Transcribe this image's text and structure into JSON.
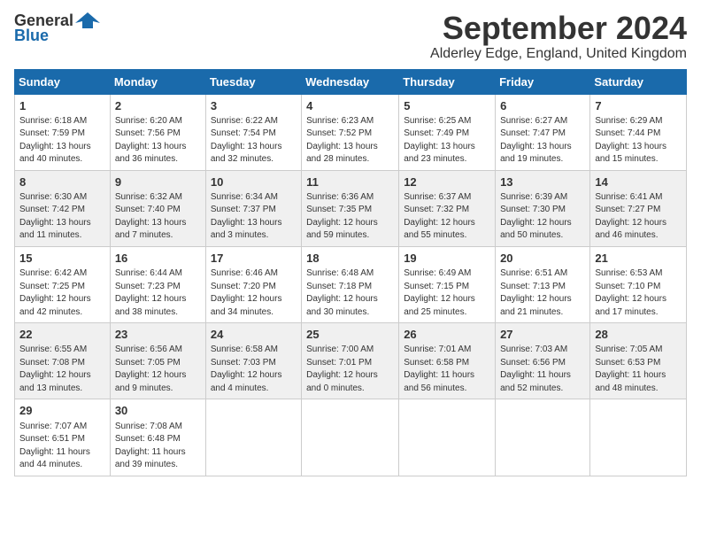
{
  "header": {
    "logo_general": "General",
    "logo_blue": "Blue",
    "month_title": "September 2024",
    "location": "Alderley Edge, England, United Kingdom"
  },
  "days_of_week": [
    "Sunday",
    "Monday",
    "Tuesday",
    "Wednesday",
    "Thursday",
    "Friday",
    "Saturday"
  ],
  "weeks": [
    [
      {
        "day": "1",
        "info": "Sunrise: 6:18 AM\nSunset: 7:59 PM\nDaylight: 13 hours\nand 40 minutes."
      },
      {
        "day": "2",
        "info": "Sunrise: 6:20 AM\nSunset: 7:56 PM\nDaylight: 13 hours\nand 36 minutes."
      },
      {
        "day": "3",
        "info": "Sunrise: 6:22 AM\nSunset: 7:54 PM\nDaylight: 13 hours\nand 32 minutes."
      },
      {
        "day": "4",
        "info": "Sunrise: 6:23 AM\nSunset: 7:52 PM\nDaylight: 13 hours\nand 28 minutes."
      },
      {
        "day": "5",
        "info": "Sunrise: 6:25 AM\nSunset: 7:49 PM\nDaylight: 13 hours\nand 23 minutes."
      },
      {
        "day": "6",
        "info": "Sunrise: 6:27 AM\nSunset: 7:47 PM\nDaylight: 13 hours\nand 19 minutes."
      },
      {
        "day": "7",
        "info": "Sunrise: 6:29 AM\nSunset: 7:44 PM\nDaylight: 13 hours\nand 15 minutes."
      }
    ],
    [
      {
        "day": "8",
        "info": "Sunrise: 6:30 AM\nSunset: 7:42 PM\nDaylight: 13 hours\nand 11 minutes."
      },
      {
        "day": "9",
        "info": "Sunrise: 6:32 AM\nSunset: 7:40 PM\nDaylight: 13 hours\nand 7 minutes."
      },
      {
        "day": "10",
        "info": "Sunrise: 6:34 AM\nSunset: 7:37 PM\nDaylight: 13 hours\nand 3 minutes."
      },
      {
        "day": "11",
        "info": "Sunrise: 6:36 AM\nSunset: 7:35 PM\nDaylight: 12 hours\nand 59 minutes."
      },
      {
        "day": "12",
        "info": "Sunrise: 6:37 AM\nSunset: 7:32 PM\nDaylight: 12 hours\nand 55 minutes."
      },
      {
        "day": "13",
        "info": "Sunrise: 6:39 AM\nSunset: 7:30 PM\nDaylight: 12 hours\nand 50 minutes."
      },
      {
        "day": "14",
        "info": "Sunrise: 6:41 AM\nSunset: 7:27 PM\nDaylight: 12 hours\nand 46 minutes."
      }
    ],
    [
      {
        "day": "15",
        "info": "Sunrise: 6:42 AM\nSunset: 7:25 PM\nDaylight: 12 hours\nand 42 minutes."
      },
      {
        "day": "16",
        "info": "Sunrise: 6:44 AM\nSunset: 7:23 PM\nDaylight: 12 hours\nand 38 minutes."
      },
      {
        "day": "17",
        "info": "Sunrise: 6:46 AM\nSunset: 7:20 PM\nDaylight: 12 hours\nand 34 minutes."
      },
      {
        "day": "18",
        "info": "Sunrise: 6:48 AM\nSunset: 7:18 PM\nDaylight: 12 hours\nand 30 minutes."
      },
      {
        "day": "19",
        "info": "Sunrise: 6:49 AM\nSunset: 7:15 PM\nDaylight: 12 hours\nand 25 minutes."
      },
      {
        "day": "20",
        "info": "Sunrise: 6:51 AM\nSunset: 7:13 PM\nDaylight: 12 hours\nand 21 minutes."
      },
      {
        "day": "21",
        "info": "Sunrise: 6:53 AM\nSunset: 7:10 PM\nDaylight: 12 hours\nand 17 minutes."
      }
    ],
    [
      {
        "day": "22",
        "info": "Sunrise: 6:55 AM\nSunset: 7:08 PM\nDaylight: 12 hours\nand 13 minutes."
      },
      {
        "day": "23",
        "info": "Sunrise: 6:56 AM\nSunset: 7:05 PM\nDaylight: 12 hours\nand 9 minutes."
      },
      {
        "day": "24",
        "info": "Sunrise: 6:58 AM\nSunset: 7:03 PM\nDaylight: 12 hours\nand 4 minutes."
      },
      {
        "day": "25",
        "info": "Sunrise: 7:00 AM\nSunset: 7:01 PM\nDaylight: 12 hours\nand 0 minutes."
      },
      {
        "day": "26",
        "info": "Sunrise: 7:01 AM\nSunset: 6:58 PM\nDaylight: 11 hours\nand 56 minutes."
      },
      {
        "day": "27",
        "info": "Sunrise: 7:03 AM\nSunset: 6:56 PM\nDaylight: 11 hours\nand 52 minutes."
      },
      {
        "day": "28",
        "info": "Sunrise: 7:05 AM\nSunset: 6:53 PM\nDaylight: 11 hours\nand 48 minutes."
      }
    ],
    [
      {
        "day": "29",
        "info": "Sunrise: 7:07 AM\nSunset: 6:51 PM\nDaylight: 11 hours\nand 44 minutes."
      },
      {
        "day": "30",
        "info": "Sunrise: 7:08 AM\nSunset: 6:48 PM\nDaylight: 11 hours\nand 39 minutes."
      },
      null,
      null,
      null,
      null,
      null
    ]
  ]
}
